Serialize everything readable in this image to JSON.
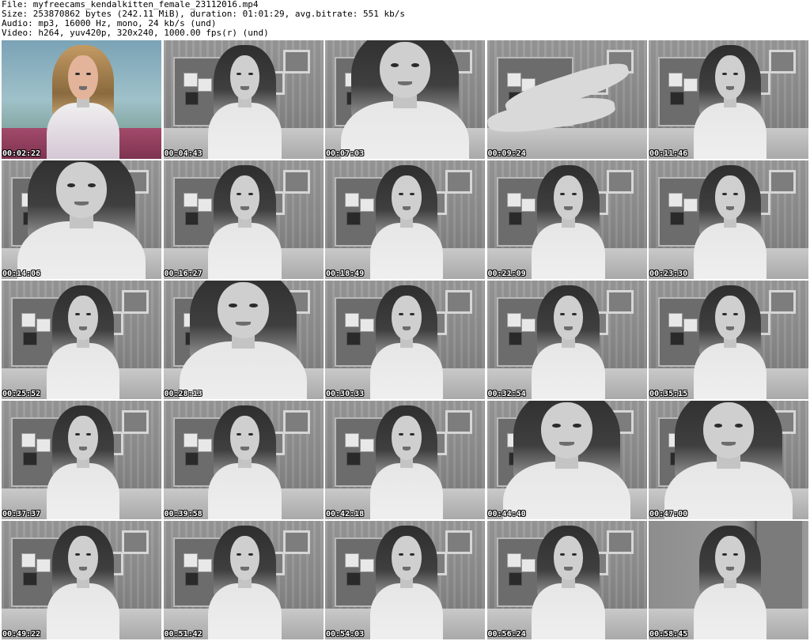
{
  "header": {
    "file_line": "File: myfreecams_kendalkitten_female_23112016.mp4",
    "size_line": "Size: 253870862 bytes (242.11 MiB), duration: 01:01:29, avg.bitrate: 551 kb/s",
    "audio_line": "Audio: mp3, 16000 Hz, mono, 24 kb/s (und)",
    "video_line": "Video: h264, yuv420p, 320x240, 1000.00 fps(r) (und)"
  },
  "thumbnails": [
    {
      "timestamp": "00:02:22",
      "variant": "color"
    },
    {
      "timestamp": "00:04:43",
      "variant": "normal"
    },
    {
      "timestamp": "00:07:03",
      "variant": "closeup"
    },
    {
      "timestamp": "00:09:24",
      "variant": "legs"
    },
    {
      "timestamp": "00:11:46",
      "variant": "normal"
    },
    {
      "timestamp": "00:14:06",
      "variant": "closeup"
    },
    {
      "timestamp": "00:16:27",
      "variant": "normal"
    },
    {
      "timestamp": "00:18:49",
      "variant": "normal"
    },
    {
      "timestamp": "00:21:09",
      "variant": "normal"
    },
    {
      "timestamp": "00:23:30",
      "variant": "normal"
    },
    {
      "timestamp": "00:25:52",
      "variant": "normal"
    },
    {
      "timestamp": "00:28:13",
      "variant": "closeup"
    },
    {
      "timestamp": "00:30:33",
      "variant": "normal"
    },
    {
      "timestamp": "00:32:54",
      "variant": "normal"
    },
    {
      "timestamp": "00:35:15",
      "variant": "normal"
    },
    {
      "timestamp": "00:37:37",
      "variant": "normal"
    },
    {
      "timestamp": "00:39:58",
      "variant": "normal"
    },
    {
      "timestamp": "00:42:18",
      "variant": "normal"
    },
    {
      "timestamp": "00:44:40",
      "variant": "closeup"
    },
    {
      "timestamp": "00:47:00",
      "variant": "closeup"
    },
    {
      "timestamp": "00:49:22",
      "variant": "normal"
    },
    {
      "timestamp": "00:51:42",
      "variant": "normal"
    },
    {
      "timestamp": "00:54:03",
      "variant": "normal"
    },
    {
      "timestamp": "00:56:24",
      "variant": "normal"
    },
    {
      "timestamp": "00:58:45",
      "variant": "door"
    }
  ]
}
